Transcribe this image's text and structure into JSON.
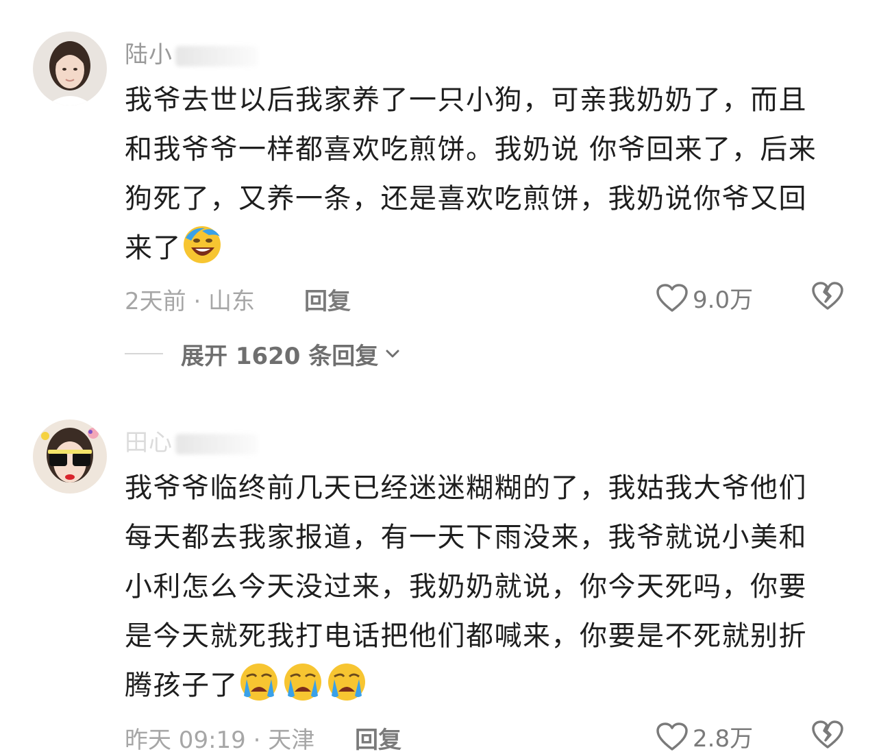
{
  "comments": [
    {
      "username": "陆小",
      "body": "我爷去世以后我家养了一只小狗，可亲我奶奶了，而且和我爷爷一样都喜欢吃煎饼。我奶说 你爷回来了，后来狗死了，又养一条，还是喜欢吃煎饼，我奶说你爷又回来了",
      "emojis": [
        "laugh-cry-emoji"
      ],
      "time_location": "2天前 · 山东",
      "reply_label": "回复",
      "likes": "9.0万",
      "expand_label": "展开 1620 条回复"
    },
    {
      "username": "田心",
      "body": "我爷爷临终前几天已经迷迷糊糊的了，我姑我大爷他们每天都去我家报道，有一天下雨没来，我爷就说小美和小利怎么今天没过来，我奶奶就说，你今天死吗，你要是今天就死我打电话把他们都喊来，你要是不死就别折腾孩子了",
      "emojis": [
        "crying-emoji",
        "crying-emoji",
        "crying-emoji"
      ],
      "time_location": "昨天 09:19 · 天津",
      "reply_label": "回复",
      "likes": "2.8万"
    }
  ],
  "colors": {
    "text": "#1e1e1e",
    "meta": "#a6a6a6",
    "icon": "#7a7a7a",
    "emoji_face": "#f7c531"
  },
  "icons": [
    "heart-icon",
    "broken-heart-icon",
    "chevron-down-icon"
  ]
}
